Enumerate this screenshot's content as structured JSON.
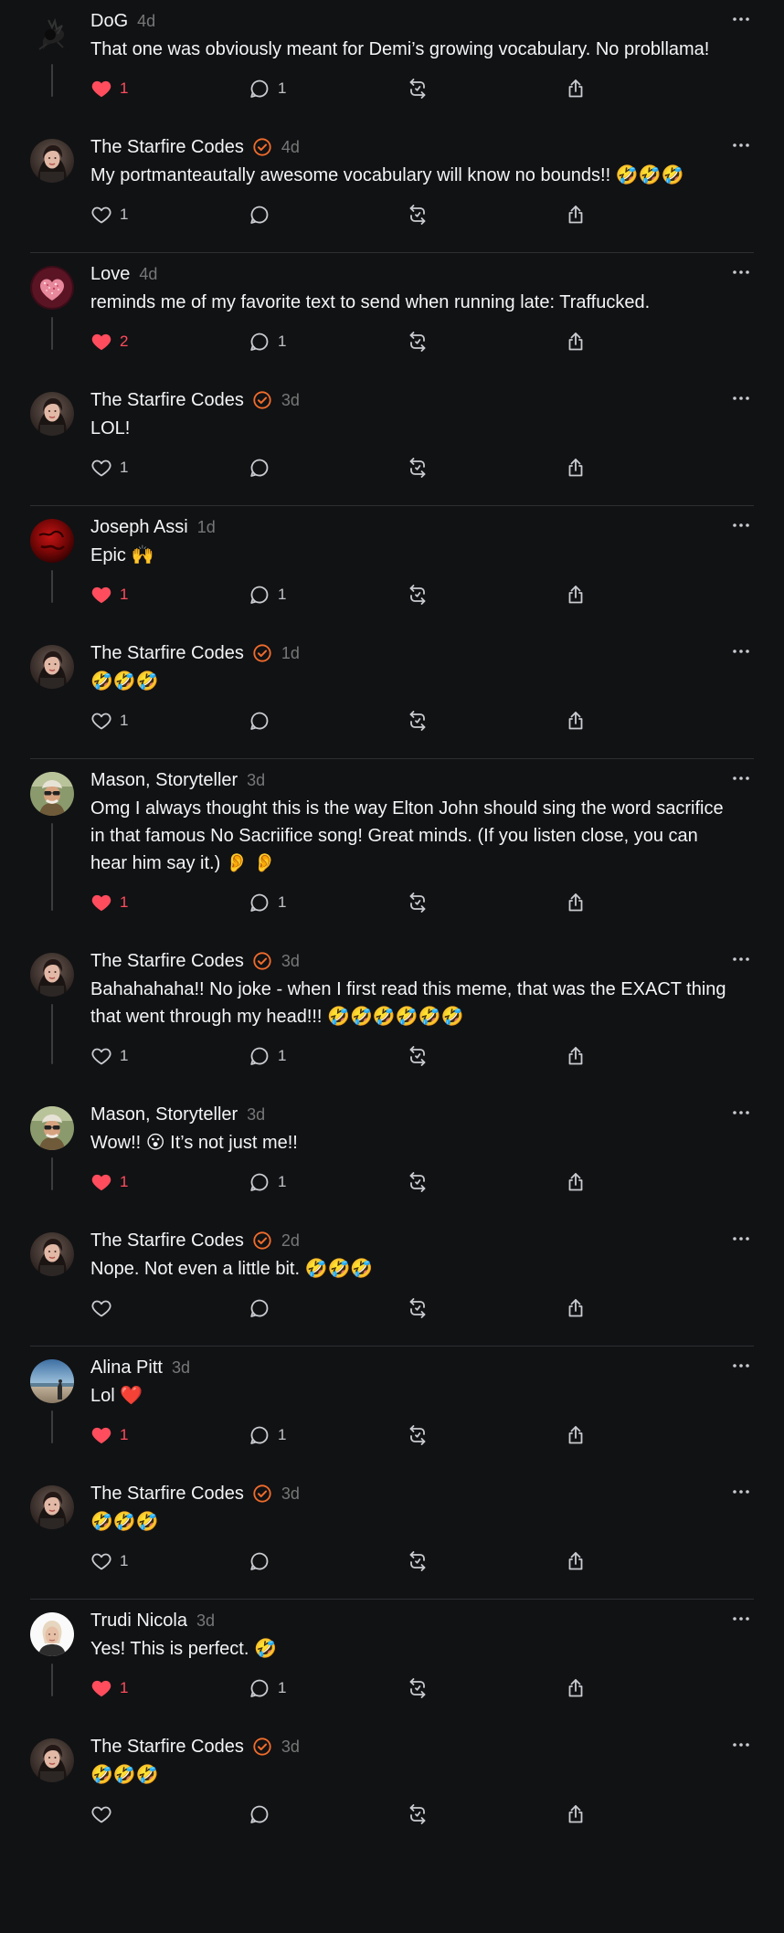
{
  "colors": {
    "background": "#111214",
    "like_active": "#ff4d5d",
    "verified_badge": "#f06c2c",
    "divider": "#2d2f33",
    "muted_text": "#777777"
  },
  "icons": {
    "like": "heart-icon",
    "reply": "comment-bubble-icon",
    "repost": "repost-icon",
    "share": "share-icon",
    "more": "more-dots-icon",
    "verified": "verified-check-icon"
  },
  "threads": [
    {
      "posts": [
        {
          "author": "DoG",
          "verified": false,
          "time": "4d",
          "text": "That one was obviously meant for Demi’s growing vocabulary. No probllama!",
          "liked": true,
          "likes": "1",
          "replies": "1",
          "avatar": "dog"
        },
        {
          "author": "The Starfire Codes",
          "verified": true,
          "time": "4d",
          "text": "My portmanteautally awesome vocabulary will know no bounds!! 🤣🤣🤣",
          "liked": false,
          "likes": "1",
          "replies": "",
          "avatar": "starfire"
        }
      ]
    },
    {
      "posts": [
        {
          "author": "Love",
          "verified": false,
          "time": "4d",
          "text": "reminds me of my favorite text to send when running late: Traffucked.",
          "liked": true,
          "likes": "2",
          "replies": "1",
          "avatar": "love"
        },
        {
          "author": "The Starfire Codes",
          "verified": true,
          "time": "3d",
          "text": "LOL!",
          "liked": false,
          "likes": "1",
          "replies": "",
          "avatar": "starfire"
        }
      ]
    },
    {
      "posts": [
        {
          "author": "Joseph Assi",
          "verified": false,
          "time": "1d",
          "text": "Epic 🙌",
          "liked": true,
          "likes": "1",
          "replies": "1",
          "avatar": "joseph"
        },
        {
          "author": "The Starfire Codes",
          "verified": true,
          "time": "1d",
          "text": "🤣🤣🤣",
          "liked": false,
          "likes": "1",
          "replies": "",
          "avatar": "starfire"
        }
      ]
    },
    {
      "posts": [
        {
          "author": "Mason, Storyteller",
          "verified": false,
          "time": "3d",
          "text": "Omg I always thought this is the way Elton John should sing the word sacrifice in that famous No Sacriifice song! Great minds. (If you listen close, you can hear him say it.) 👂 👂",
          "liked": true,
          "likes": "1",
          "replies": "1",
          "avatar": "mason"
        },
        {
          "author": "The Starfire Codes",
          "verified": true,
          "time": "3d",
          "text": "Bahahahaha!! No joke - when I first read this meme, that was the EXACT thing that went through my head!!! 🤣🤣🤣🤣🤣🤣",
          "liked": false,
          "likes": "1",
          "replies": "1",
          "avatar": "starfire"
        },
        {
          "author": "Mason, Storyteller",
          "verified": false,
          "time": "3d",
          "text": "Wow!! 😮 It’s not just me!!",
          "liked": true,
          "likes": "1",
          "replies": "1",
          "avatar": "mason"
        },
        {
          "author": "The Starfire Codes",
          "verified": true,
          "time": "2d",
          "text": "Nope. Not even a little bit. 🤣🤣🤣",
          "liked": false,
          "likes": "",
          "replies": "",
          "avatar": "starfire"
        }
      ]
    },
    {
      "posts": [
        {
          "author": "Alina Pitt",
          "verified": false,
          "time": "3d",
          "text": "Lol ❤️",
          "liked": true,
          "likes": "1",
          "replies": "1",
          "avatar": "alina"
        },
        {
          "author": "The Starfire Codes",
          "verified": true,
          "time": "3d",
          "text": "🤣🤣🤣",
          "liked": false,
          "likes": "1",
          "replies": "",
          "avatar": "starfire"
        }
      ]
    },
    {
      "posts": [
        {
          "author": "Trudi Nicola",
          "verified": false,
          "time": "3d",
          "text": "Yes! This is perfect. 🤣",
          "liked": true,
          "likes": "1",
          "replies": "1",
          "avatar": "trudi"
        },
        {
          "author": "The Starfire Codes",
          "verified": true,
          "time": "3d",
          "text": "🤣🤣🤣",
          "liked": false,
          "likes": "",
          "replies": "",
          "avatar": "starfire"
        }
      ]
    }
  ]
}
